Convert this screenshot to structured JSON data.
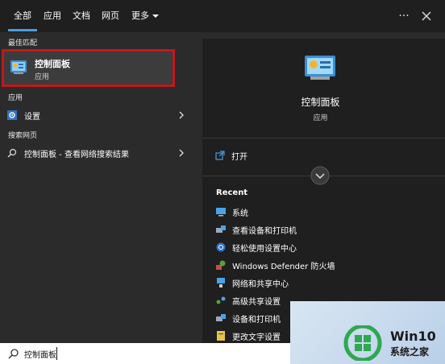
{
  "tabs": [
    {
      "label": "全部"
    },
    {
      "label": "应用"
    },
    {
      "label": "文档"
    },
    {
      "label": "网页"
    },
    {
      "label": "更多"
    }
  ],
  "top_actions": {
    "ellipsis": "···"
  },
  "left": {
    "best_match_header": "最佳匹配",
    "best_match": {
      "title": "控制面板",
      "subtitle": "应用"
    },
    "apps_header": "应用",
    "settings_label": "设置",
    "web_header": "搜索网页",
    "web_item_label": "控制面板 - 查看网络搜索结果"
  },
  "right": {
    "app_name": "控制面板",
    "app_type": "应用",
    "open_label": "打开",
    "recent_title": "Recent",
    "recent_items": [
      {
        "label": "系统",
        "icon": "monitor-icon"
      },
      {
        "label": "查看设备和打印机",
        "icon": "printer-icon"
      },
      {
        "label": "轻松使用设置中心",
        "icon": "ease-of-access-icon"
      },
      {
        "label": "Windows Defender 防火墙",
        "icon": "firewall-icon"
      },
      {
        "label": "网络和共享中心",
        "icon": "network-icon"
      },
      {
        "label": "高级共享设置",
        "icon": "share-icon"
      },
      {
        "label": "设备和打印机",
        "icon": "printer-icon"
      },
      {
        "label": "更改文字设置",
        "icon": "text-settings-icon"
      }
    ]
  },
  "search": {
    "value": "控制面板"
  },
  "watermark": {
    "brand": "Win10",
    "site": "系统之家"
  },
  "colors": {
    "accent": "#4a9de0",
    "highlight_border": "#c4161c",
    "panel_dark": "#1f1f1f",
    "panel_left": "#2b2b2b"
  }
}
